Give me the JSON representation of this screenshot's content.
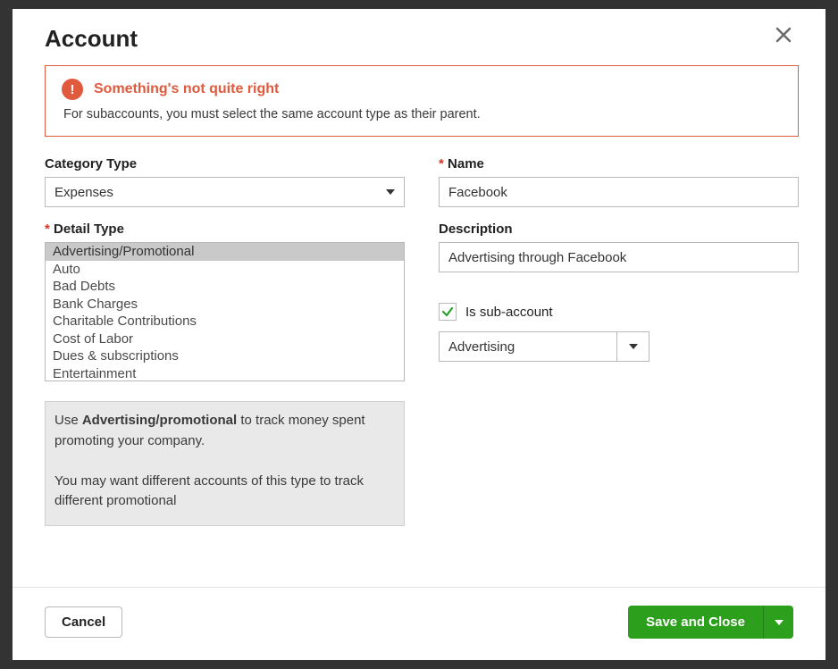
{
  "modal": {
    "title": "Account"
  },
  "alert": {
    "title": "Something's not quite right",
    "message": "For subaccounts, you must select the same account type as their parent."
  },
  "left": {
    "category_label": "Category Type",
    "category_value": "Expenses",
    "detail_label": "Detail Type",
    "detail_options": [
      "Advertising/Promotional",
      "Auto",
      "Bad Debts",
      "Bank Charges",
      "Charitable Contributions",
      "Cost of Labor",
      "Dues & subscriptions",
      "Entertainment"
    ],
    "detail_selected_index": 0,
    "help_prefix": "Use ",
    "help_bold": "Advertising/promotional",
    "help_suffix": " to track money spent promoting your company.",
    "help_p2": "You may want different accounts of this type to track different promotional"
  },
  "right": {
    "name_label": "Name",
    "name_value": "Facebook",
    "desc_label": "Description",
    "desc_value": "Advertising through Facebook",
    "sub_label": "Is sub-account",
    "sub_checked": true,
    "parent_value": "Advertising"
  },
  "footer": {
    "cancel": "Cancel",
    "save": "Save and Close"
  }
}
